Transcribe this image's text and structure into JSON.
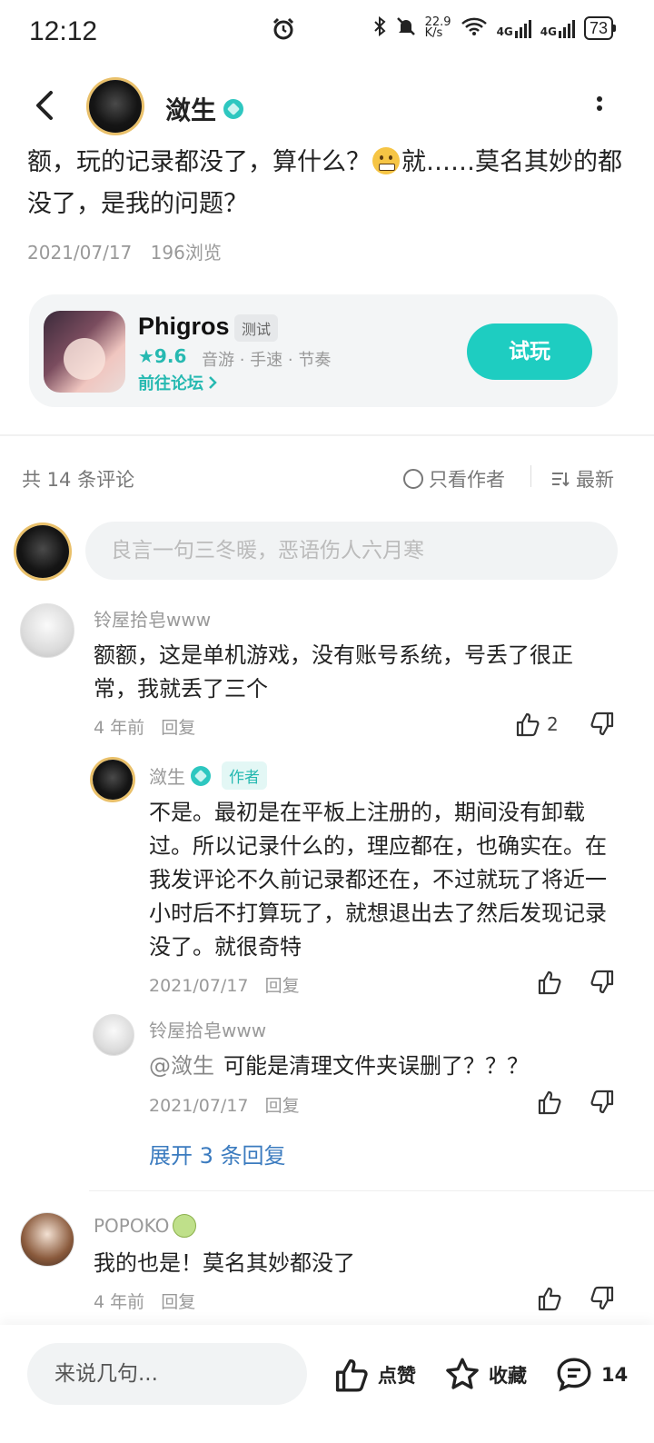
{
  "status_bar": {
    "time": "12:12",
    "net_speed": "22.9",
    "net_unit": "K/s",
    "signal1": "4G",
    "signal2": "4G",
    "battery": "73"
  },
  "header": {
    "author_name": "潋生"
  },
  "post": {
    "text_before_emoji": "额，玩的记录都没了，算什么？",
    "text_after_emoji": "就……莫名其妙的都没了，是我的问题？",
    "date": "2021/07/17",
    "views": "196浏览"
  },
  "game_card": {
    "name": "Phigros",
    "tag": "测试",
    "rating": "★9.6",
    "genres": "音游 · 手速 · 节奏",
    "forum_link": "前往论坛",
    "try_button": "试玩"
  },
  "comments_bar": {
    "count": "共 14 条评论",
    "only_author": "只看作者",
    "sort": "最新",
    "input_placeholder": "良言一句三冬暖，恶语伤人六月寒"
  },
  "comments": [
    {
      "name": "铃屋拾皂www",
      "text": "额额，这是单机游戏，没有账号系统，号丢了很正常，我就丢了三个",
      "time": "4 年前",
      "reply": "回复",
      "likes": "2"
    },
    {
      "name": "潋生",
      "badge": "作者",
      "text": "不是。最初是在平板上注册的，期间没有卸载过。所以记录什么的，理应都在，也确实在。在我发评论不久前记录都还在，不过就玩了将近一小时后不打算玩了，就想退出去了然后发现记录没了。就很奇特",
      "time": "2021/07/17",
      "reply": "回复"
    },
    {
      "name": "铃屋拾皂www",
      "mention": "@潋生",
      "text": "可能是清理文件夹误删了？？？",
      "time": "2021/07/17",
      "reply": "回复"
    },
    {
      "name": "POPOKO",
      "text": "我的也是！莫名其妙都没了",
      "time": "4 年前",
      "reply": "回复"
    }
  ],
  "expand_replies": "展开 3 条回复",
  "bottom_bar": {
    "input_placeholder": "来说几句...",
    "like_label": "点赞",
    "favorite_label": "收藏",
    "comment_count": "14"
  },
  "colors": {
    "accent": "#1ecdc1",
    "link": "#3b7bbf"
  }
}
